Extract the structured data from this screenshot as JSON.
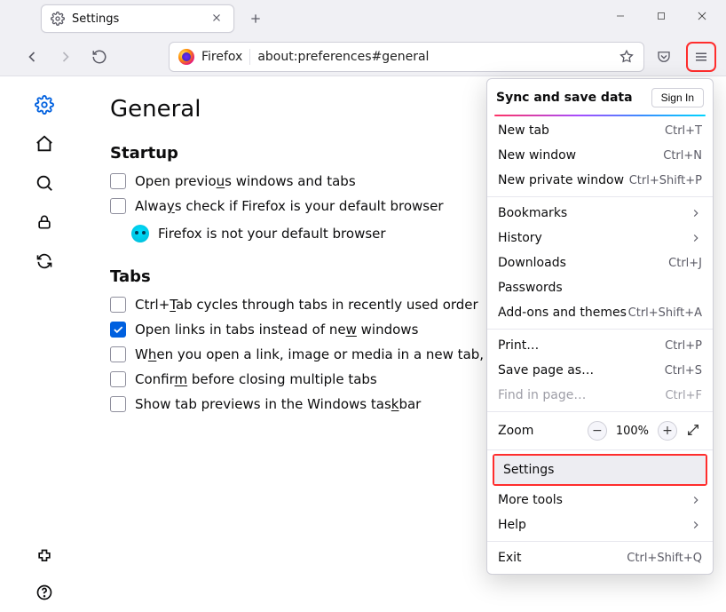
{
  "window": {
    "tab_title": "Settings"
  },
  "toolbar": {
    "product": "Firefox",
    "address": "about:preferences#general"
  },
  "page": {
    "title": "General",
    "startup": {
      "heading": "Startup",
      "open_previous_pre": "Open previo",
      "open_previous_under": "u",
      "open_previous_post": "s windows and tabs",
      "always_default_pre": "Alwa",
      "always_default_under": "y",
      "always_default_post": "s check if Firefox is your default browser",
      "not_default": "Firefox is not your default browser"
    },
    "tabs": {
      "heading": "Tabs",
      "ctrl_tab_pre": "Ctrl+",
      "ctrl_tab_under": "T",
      "ctrl_tab_post": "ab cycles through tabs in recently used order",
      "open_links_pre": "Open links in tabs instead of ne",
      "open_links_under": "w",
      "open_links_post": " windows",
      "switch_pre": "W",
      "switch_under": "h",
      "switch_post": "en you open a link, image or media in a new tab, switch t",
      "confirm_pre": "Confir",
      "confirm_under": "m",
      "confirm_post": " before closing multiple tabs",
      "taskbar_pre": "Show tab previews in the Windows tas",
      "taskbar_under": "k",
      "taskbar_post": "bar"
    }
  },
  "menu": {
    "sync_title": "Sync and save data",
    "sign_in": "Sign In",
    "new_tab": {
      "label": "New tab",
      "shortcut": "Ctrl+T"
    },
    "new_window": {
      "label": "New window",
      "shortcut": "Ctrl+N"
    },
    "new_private": {
      "label": "New private window",
      "shortcut": "Ctrl+Shift+P"
    },
    "bookmarks": {
      "label": "Bookmarks"
    },
    "history": {
      "label": "History"
    },
    "downloads": {
      "label": "Downloads",
      "shortcut": "Ctrl+J"
    },
    "passwords": {
      "label": "Passwords"
    },
    "addons": {
      "label": "Add-ons and themes",
      "shortcut": "Ctrl+Shift+A"
    },
    "print": {
      "label": "Print…",
      "shortcut": "Ctrl+P"
    },
    "save_as": {
      "label": "Save page as…",
      "shortcut": "Ctrl+S"
    },
    "find": {
      "label": "Find in page…",
      "shortcut": "Ctrl+F"
    },
    "zoom": {
      "label": "Zoom",
      "value": "100%"
    },
    "settings": {
      "label": "Settings"
    },
    "more_tools": {
      "label": "More tools"
    },
    "help": {
      "label": "Help"
    },
    "exit": {
      "label": "Exit",
      "shortcut": "Ctrl+Shift+Q"
    }
  }
}
